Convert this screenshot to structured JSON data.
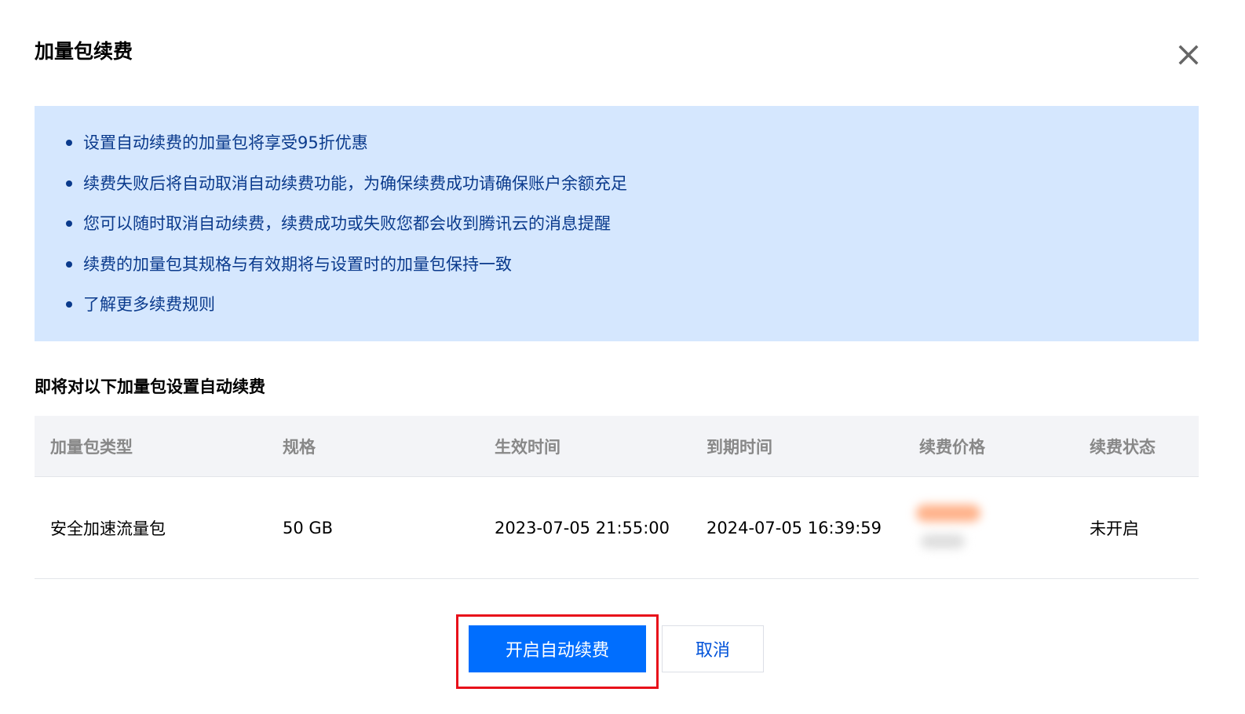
{
  "dialog": {
    "title": "加量包续费",
    "close_icon": "close-icon"
  },
  "notice": {
    "items": [
      "设置自动续费的加量包将享受95折优惠",
      "续费失败后将自动取消自动续费功能，为确保续费成功请确保账户余额充足",
      "您可以随时取消自动续费，续费成功或失败您都会收到腾讯云的消息提醒",
      "续费的加量包其规格与有效期将与设置时的加量包保持一致",
      "了解更多续费规则"
    ]
  },
  "section_title": "即将对以下加量包设置自动续费",
  "table": {
    "headers": [
      "加量包类型",
      "规格",
      "生效时间",
      "到期时间",
      "续费价格",
      "续费状态"
    ],
    "rows": [
      {
        "type": "安全加速流量包",
        "spec": "50 GB",
        "start": "2023-07-05 21:55:00",
        "end": "2024-07-05 16:39:59",
        "status": "未开启"
      }
    ]
  },
  "footer": {
    "confirm_label": "开启自动续费",
    "cancel_label": "取消"
  },
  "colors": {
    "primary": "#006efe",
    "notice_bg": "#d5e7fe",
    "notice_text": "#0a3a8c",
    "highlight": "#e8101a"
  }
}
